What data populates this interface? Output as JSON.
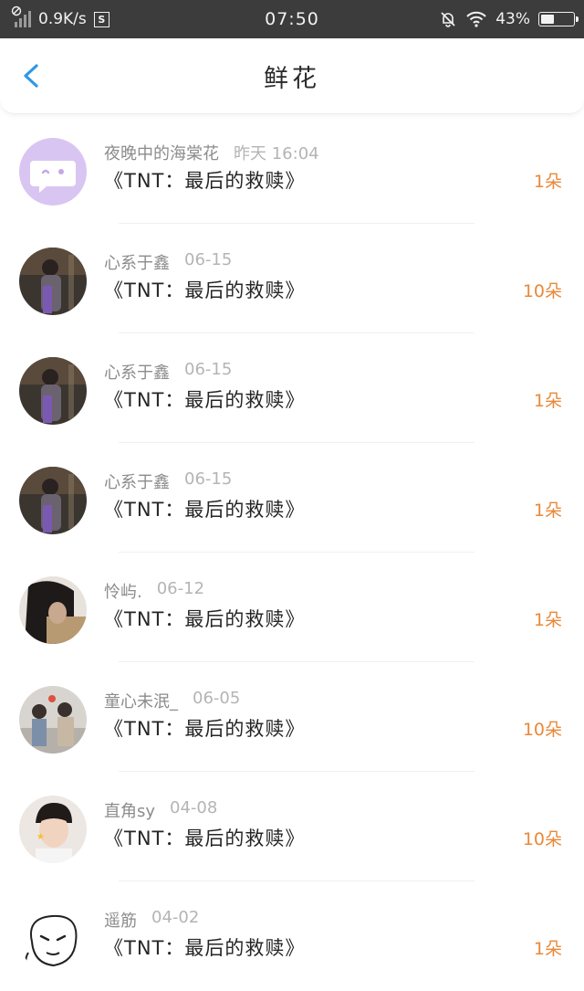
{
  "status_bar": {
    "network_speed": "0.9K/s",
    "s_icon_label": "S",
    "time": "07:50",
    "battery_percent": "43%",
    "battery_level": 0.43
  },
  "header": {
    "title": "鲜花"
  },
  "items": [
    {
      "name": "夜晚中的海棠花",
      "date": "昨天 16:04",
      "work": "《TNT：最后的救赎》",
      "count": "1朵",
      "avatar": "purple-chat-bubble"
    },
    {
      "name": "心系于鑫",
      "date": "06-15",
      "work": "《TNT：最后的救赎》",
      "count": "10朵",
      "avatar": "photo-boy-night"
    },
    {
      "name": "心系于鑫",
      "date": "06-15",
      "work": "《TNT：最后的救赎》",
      "count": "1朵",
      "avatar": "photo-boy-night"
    },
    {
      "name": "心系于鑫",
      "date": "06-15",
      "work": "《TNT：最后的救赎》",
      "count": "1朵",
      "avatar": "photo-boy-night"
    },
    {
      "name": "怜屿.",
      "date": "06-12",
      "work": "《TNT：最后的救赎》",
      "count": "1朵",
      "avatar": "photo-dark-hair"
    },
    {
      "name": "童心未泯_",
      "date": "06-05",
      "work": "《TNT：最后的救赎》",
      "count": "10朵",
      "avatar": "photo-group"
    },
    {
      "name": "直角sy",
      "date": "04-08",
      "work": "《TNT：最后的救赎》",
      "count": "10朵",
      "avatar": "photo-face"
    },
    {
      "name": "遥筋",
      "date": "04-02",
      "work": "《TNT：最后的救赎》",
      "count": "1朵",
      "avatar": "cartoon-face"
    }
  ],
  "colors": {
    "status_bar_bg": "#3c3c3c",
    "back_arrow": "#2f97e6",
    "count_orange": "#e8893a"
  }
}
